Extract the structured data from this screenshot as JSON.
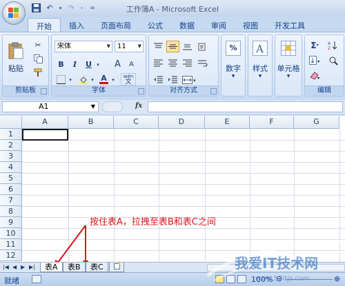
{
  "window": {
    "title": "工作簿A - Microsoft Excel"
  },
  "quick_access": {
    "customize": "="
  },
  "ribbon_tabs": [
    "开始",
    "插入",
    "页面布局",
    "公式",
    "数据",
    "审阅",
    "视图",
    "开发工具"
  ],
  "active_tab_index": 0,
  "clipboard": {
    "paste_label": "粘贴",
    "group_label": "剪贴板"
  },
  "font": {
    "name": "宋体",
    "size": "11",
    "group_label": "字体",
    "bold": "B",
    "italic": "I",
    "underline": "U",
    "grow": "A",
    "shrink": "A",
    "color_glyph": "A",
    "wen": "wén"
  },
  "alignment": {
    "group_label": "对齐方式"
  },
  "number": {
    "label": "数字",
    "symbol": "%"
  },
  "styles": {
    "label": "样式"
  },
  "cells": {
    "label": "单元格"
  },
  "editing": {
    "group_label": "编辑",
    "sigma": "Σ"
  },
  "formula_bar": {
    "name_box": "A1",
    "fx": "fx",
    "value": ""
  },
  "columns": [
    "A",
    "B",
    "C",
    "D",
    "E",
    "F",
    "G"
  ],
  "rows": [
    "1",
    "2",
    "3",
    "4",
    "5",
    "6",
    "7",
    "8",
    "9",
    "10",
    "11",
    "12"
  ],
  "annotation": "按住表A，拉拽至表B和表C之间",
  "sheets": [
    "表A",
    "表B",
    "表C"
  ],
  "active_sheet": "表A",
  "status": {
    "ready": "就绪",
    "zoom": "100%"
  },
  "watermark": {
    "text": "我爱IT技术网",
    "url": "www.52itjs.com"
  },
  "colors": {
    "annotation": "#d7141a",
    "ribbon_text": "#15428b"
  }
}
